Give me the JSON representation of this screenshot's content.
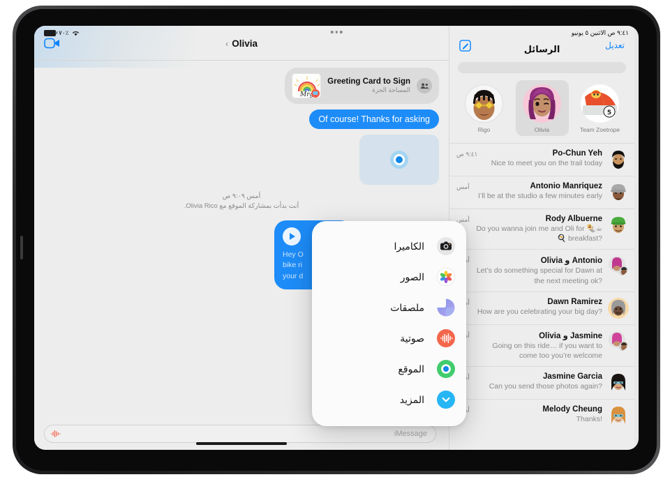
{
  "status_bar": {
    "battery_icon": "battery-icon",
    "battery_text": "٧٠٪",
    "wifi_icon": "wifi-icon",
    "datetime": "٩:٤١ ص   الاثنين ٥ يونيو"
  },
  "chat": {
    "facetime_icon": "video-camera-icon",
    "back_chevron": "‹",
    "title": "Olivia",
    "messages": {
      "card": {
        "title": "Greeting Card to Sign",
        "subtitle": "المساحة الحرة",
        "avatar_icon": "people-group-icon"
      },
      "outgoing_text": "Of course! Thanks for asking",
      "location_bubble_icon": "location-dot-icon",
      "system_note_time": "أمس ٩:٠٩ ص",
      "system_note_text": "أنت بدأت بمشاركة الموقع مع Olivia Rico.",
      "video_bubble": {
        "play_icon": "play-icon",
        "line1": "Hey O",
        "line2": "bike ri",
        "line3": "your d"
      }
    },
    "input": {
      "audio_icon": "audio-waveform-icon",
      "placeholder": "iMessage"
    }
  },
  "plus_menu": {
    "items": [
      {
        "label": "الكاميرا",
        "icon": "camera-icon"
      },
      {
        "label": "الصور",
        "icon": "photos-icon"
      },
      {
        "label": "ملصقات",
        "icon": "stickers-icon"
      },
      {
        "label": "صوتية",
        "icon": "audio-icon"
      },
      {
        "label": "الموقع",
        "icon": "location-icon"
      },
      {
        "label": "المزيد",
        "icon": "chevron-down-icon"
      }
    ]
  },
  "sidebar": {
    "compose_icon": "compose-icon",
    "title": "الرسائل",
    "edit_label": "تعديل",
    "search_placeholder": "",
    "pinned": [
      {
        "name": "Rigo"
      },
      {
        "name": "Olivia"
      },
      {
        "name": "Team Zoetrope"
      }
    ],
    "conversations": [
      {
        "name": "Po-Chun Yeh",
        "preview": "Nice to meet you on the trail today",
        "time": "٩:٤١ ص"
      },
      {
        "name": "Antonio Manriquez",
        "preview": "I’ll be at the studio a few minutes early",
        "time": "أمس"
      },
      {
        "name": "Rody Albuerne",
        "preview": "Do you wanna join me and Oli for 🌯☕🍳 breakfast?",
        "time": "أمس"
      },
      {
        "name": "Olivia و Antonio",
        "preview": "Let’s do something special for Dawn at the next meeting ok?",
        "time": "أمس"
      },
      {
        "name": "Dawn Ramirez",
        "preview": "How are you celebrating your big day?",
        "time": "أمس"
      },
      {
        "name": "Olivia و Jasmine",
        "preview": "Going on this ride… if you want to come too you’re welcome",
        "time": "أمس"
      },
      {
        "name": "Jasmine Garcia",
        "preview": "Can you send those photos again?",
        "time": "أمس"
      },
      {
        "name": "Melody Cheung",
        "preview": "Thanks!",
        "time": "أمس"
      }
    ]
  },
  "colors": {
    "accent_blue": "#0a84ff",
    "bubble_blue": "#1d8cf8",
    "background": "#ededed"
  }
}
